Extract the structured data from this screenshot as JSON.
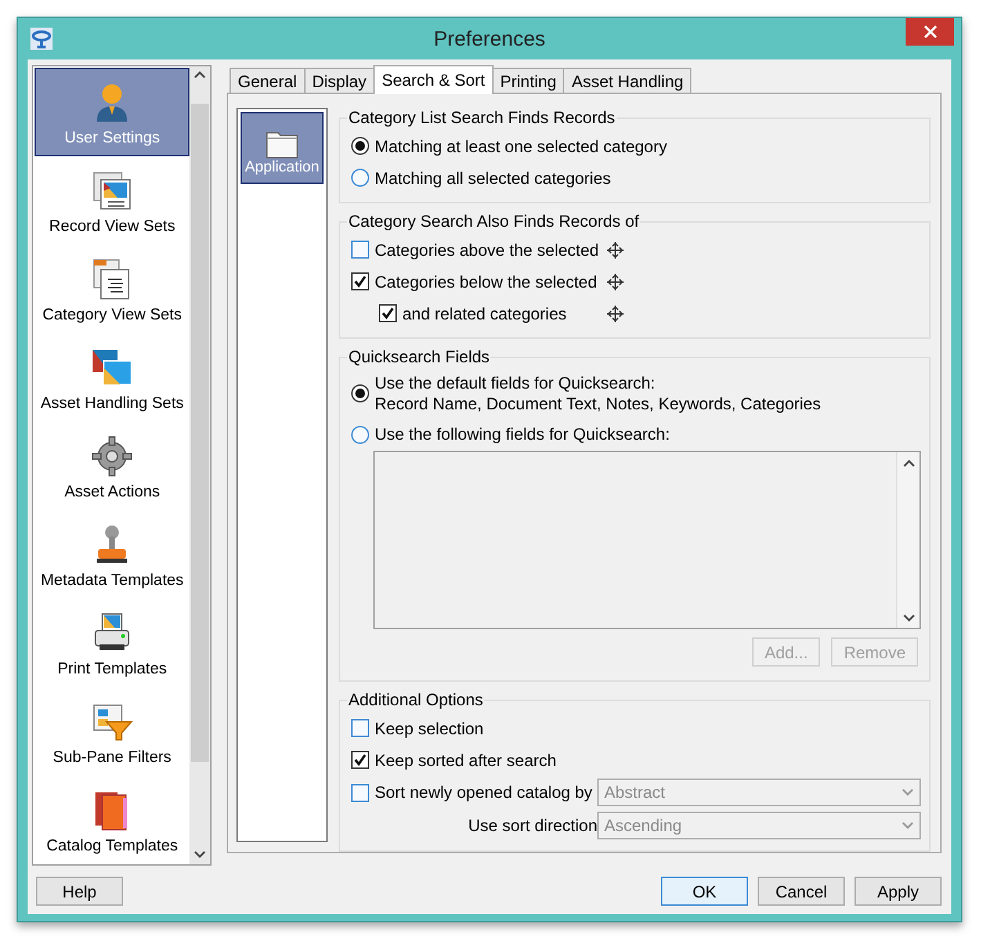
{
  "window": {
    "title": "Preferences"
  },
  "sidebar": {
    "items": [
      {
        "label": "User Settings",
        "selected": true
      },
      {
        "label": "Record View Sets",
        "selected": false
      },
      {
        "label": "Category View Sets",
        "selected": false
      },
      {
        "label": "Asset Handling Sets",
        "selected": false
      },
      {
        "label": "Asset Actions",
        "selected": false
      },
      {
        "label": "Metadata Templates",
        "selected": false
      },
      {
        "label": "Print Templates",
        "selected": false
      },
      {
        "label": "Sub-Pane Filters",
        "selected": false
      },
      {
        "label": "Catalog Templates",
        "selected": false
      }
    ]
  },
  "tabs": [
    {
      "label": "General",
      "selected": false
    },
    {
      "label": "Display",
      "selected": false
    },
    {
      "label": "Search & Sort",
      "selected": true
    },
    {
      "label": "Printing",
      "selected": false
    },
    {
      "label": "Asset Handling",
      "selected": false
    }
  ],
  "pages": [
    {
      "label": "Application",
      "selected": true
    }
  ],
  "sections": [
    {
      "kind": "radios",
      "title": "Category List Search Finds Records",
      "options": [
        {
          "label": "Matching at least one selected category",
          "selected": true
        },
        {
          "label": "Matching all selected categories",
          "selected": false
        }
      ]
    },
    {
      "kind": "checks",
      "title": "Category Search Also Finds Records of",
      "options": [
        {
          "label": "Categories above the selected",
          "checked": false
        },
        {
          "label": "Categories below the selected",
          "checked": true,
          "children": [
            {
              "label": "and related categories",
              "checked": true
            }
          ]
        }
      ]
    },
    {
      "kind": "quicksearch",
      "title": "Quicksearch Fields",
      "options": [
        {
          "label": "Use the default fields for Quicksearch:",
          "detail": "Record Name, Document Text, Notes, Keywords, Categories",
          "selected": true
        },
        {
          "label": "Use the following fields for Quicksearch:",
          "selected": false
        }
      ],
      "buttons": [
        {
          "label": "Add...",
          "disabled": true
        },
        {
          "label": "Remove",
          "disabled": true
        }
      ]
    },
    {
      "kind": "additional",
      "title": "Additional Options",
      "rows": [
        {
          "kind": "check",
          "label": "Keep selection",
          "checked": false
        },
        {
          "kind": "check",
          "label": "Keep sorted after search",
          "checked": true
        },
        {
          "kind": "check-select",
          "label": "Sort newly opened catalog by",
          "checked": false,
          "value": "Abstract",
          "disabled": true
        },
        {
          "kind": "select",
          "label": "Use sort direction",
          "value": "Ascending",
          "disabled": true
        }
      ]
    }
  ],
  "buttons": [
    {
      "label": "Help",
      "default": false
    },
    {
      "label": "OK",
      "default": true
    },
    {
      "label": "Cancel",
      "default": false
    },
    {
      "label": "Apply",
      "default": false
    }
  ]
}
